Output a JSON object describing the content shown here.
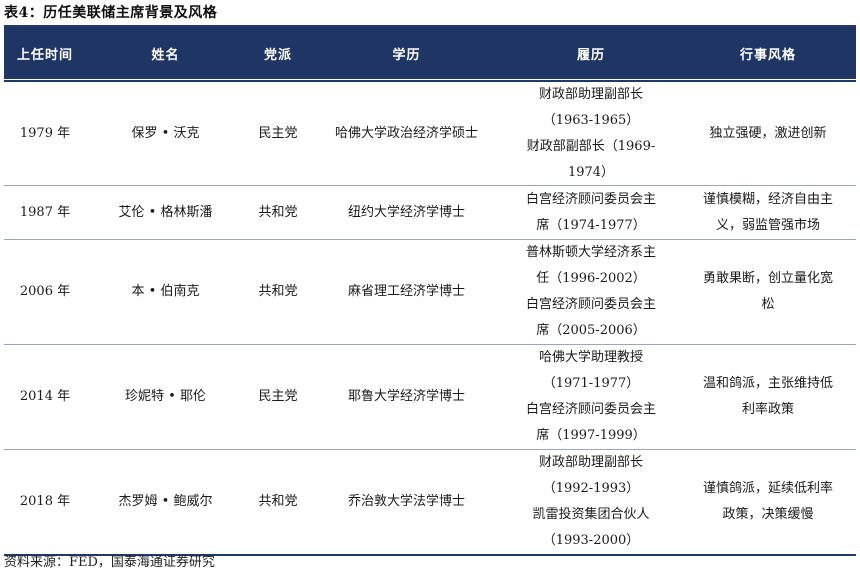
{
  "caption": "表4：历任美联储主席背景及风格",
  "headers": {
    "term": "上任时间",
    "name": "姓名",
    "party": "党派",
    "education": "学历",
    "experience": "履历",
    "style": "行事风格"
  },
  "rows": [
    {
      "term": "1979 年",
      "name": "保罗 • 沃克",
      "party": "民主党",
      "education": "哈佛大学政治经济学硕士",
      "experience": [
        "财政部助理副部长",
        "（1963-1965）",
        "财政部副部长（1969-",
        "1974）"
      ],
      "style": [
        "独立强硬，激进创新"
      ]
    },
    {
      "term": "1987 年",
      "name": "艾伦 • 格林斯潘",
      "party": "共和党",
      "education": "纽约大学经济学博士",
      "experience": [
        "白宫经济顾问委员会主",
        "席（1974-1977）"
      ],
      "style": [
        "谨慎模糊，经济自由主",
        "义，弱监管强市场"
      ]
    },
    {
      "term": "2006 年",
      "name": "本 • 伯南克",
      "party": "共和党",
      "education": "麻省理工经济学博士",
      "experience": [
        "普林斯顿大学经济系主",
        "任（1996-2002）",
        "白宫经济顾问委员会主",
        "席（2005-2006）"
      ],
      "style": [
        "勇敢果断，创立量化宽",
        "松"
      ]
    },
    {
      "term": "2014 年",
      "name": "珍妮特 • 耶伦",
      "party": "民主党",
      "education": "耶鲁大学经济学博士",
      "experience": [
        "哈佛大学助理教授",
        "（1971-1977）",
        "白宫经济顾问委员会主",
        "席（1997-1999）"
      ],
      "style": [
        "温和鸽派，主张维持低",
        "利率政策"
      ]
    },
    {
      "term": "2018 年",
      "name": "杰罗姆 • 鲍威尔",
      "party": "共和党",
      "education": "乔治敦大学法学博士",
      "experience": [
        "财政部助理副部长",
        "（1992-1993）",
        "凯雷投资集团合伙人",
        "（1993-2000）"
      ],
      "style": [
        "谨慎鸽派，延续低利率",
        "政策，决策缓慢"
      ]
    }
  ],
  "source": "资料来源：FED，国泰海通证券研究"
}
